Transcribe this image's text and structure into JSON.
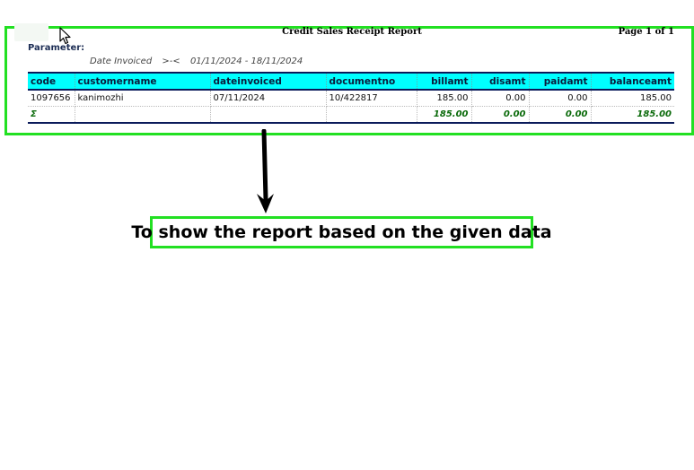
{
  "report": {
    "title": "Credit Sales Receipt Report",
    "page_info": "Page 1 of 1",
    "parameter_label": "Parameter:",
    "parameter": {
      "name": "Date Invoiced",
      "operator": ">-<",
      "value": "01/11/2024 - 18/11/2024"
    },
    "columns": [
      "code",
      "customername",
      "dateinvoiced",
      "documentno",
      "billamt",
      "disamt",
      "paidamt",
      "balanceamt"
    ],
    "rows": [
      [
        "1097656",
        "kanimozhi",
        "07/11/2024",
        "10/422817",
        "185.00",
        "0.00",
        "0.00",
        "185.00"
      ]
    ],
    "total": {
      "symbol": "Σ",
      "billamt": "185.00",
      "disamt": "0.00",
      "paidamt": "0.00",
      "balanceamt": "185.00"
    }
  },
  "caption": "To show the report based on the given data",
  "colors": {
    "highlight": "#22e022",
    "header_bg": "#00ffff",
    "total_text": "#0a6a0a"
  },
  "icons": [
    "mouse-pointer-icon",
    "arrow-down-icon"
  ]
}
